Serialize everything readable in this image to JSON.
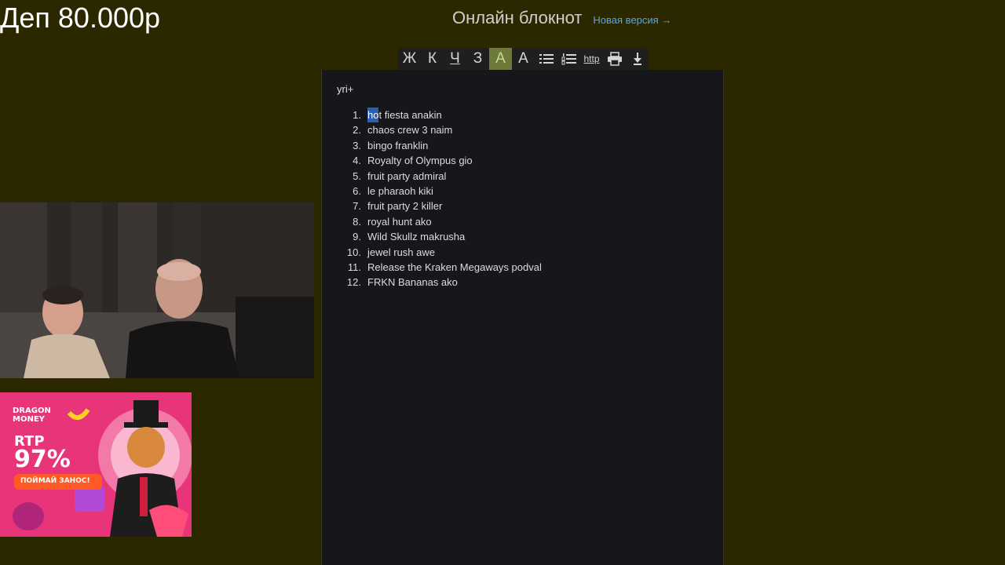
{
  "overlay": {
    "deposit": "Деп 80.000р"
  },
  "header": {
    "title": "Онлайн блокнот",
    "new_version_link": "Новая версия →"
  },
  "toolbar": {
    "bold": "Ж",
    "italic": "К",
    "underline": "Ч",
    "strike": "З",
    "highlight": "A",
    "font": "A",
    "link": "http",
    "icons": [
      "bold-icon",
      "italic-icon",
      "underline-icon",
      "strikethrough-icon",
      "highlight-icon",
      "font-color-icon",
      "bullet-list-icon",
      "numbered-list-icon",
      "link-icon",
      "print-icon",
      "download-icon"
    ]
  },
  "document": {
    "heading": "yri+",
    "items": [
      {
        "num": "1.",
        "selected": "ho",
        "text": "t fiesta anakin"
      },
      {
        "num": "2.",
        "text": "chaos crew 3 naim"
      },
      {
        "num": "3.",
        "text": "bingo franklin"
      },
      {
        "num": "4.",
        "text": "Royalty of Olympus gio"
      },
      {
        "num": "5.",
        "text": "fruit party admiral"
      },
      {
        "num": "6.",
        "text": "le pharaoh kiki"
      },
      {
        "num": "7.",
        "text": "fruit party 2 killer"
      },
      {
        "num": "8.",
        "text": "royal hunt ako"
      },
      {
        "num": "9.",
        "text": "Wild Skullz makrusha"
      },
      {
        "num": "10.",
        "text": "jewel rush awe"
      },
      {
        "num": "11.",
        "text": "Release the Kraken Megaways podval"
      },
      {
        "num": "12.",
        "text": "FRKN Bananas ako"
      }
    ]
  },
  "promo": {
    "brand_line1": "DRAGON",
    "brand_line2": "MONEY",
    "rtp_label": "RTP",
    "rtp_value": "97%",
    "cta": "ПОЙМАЙ ЗАНОС!"
  },
  "colors": {
    "page_bg": "#2b2800",
    "editor_bg": "#15171a",
    "link": "#55a7e8",
    "selection": "#2c5fb3",
    "promo_bg": "#e8357a"
  }
}
